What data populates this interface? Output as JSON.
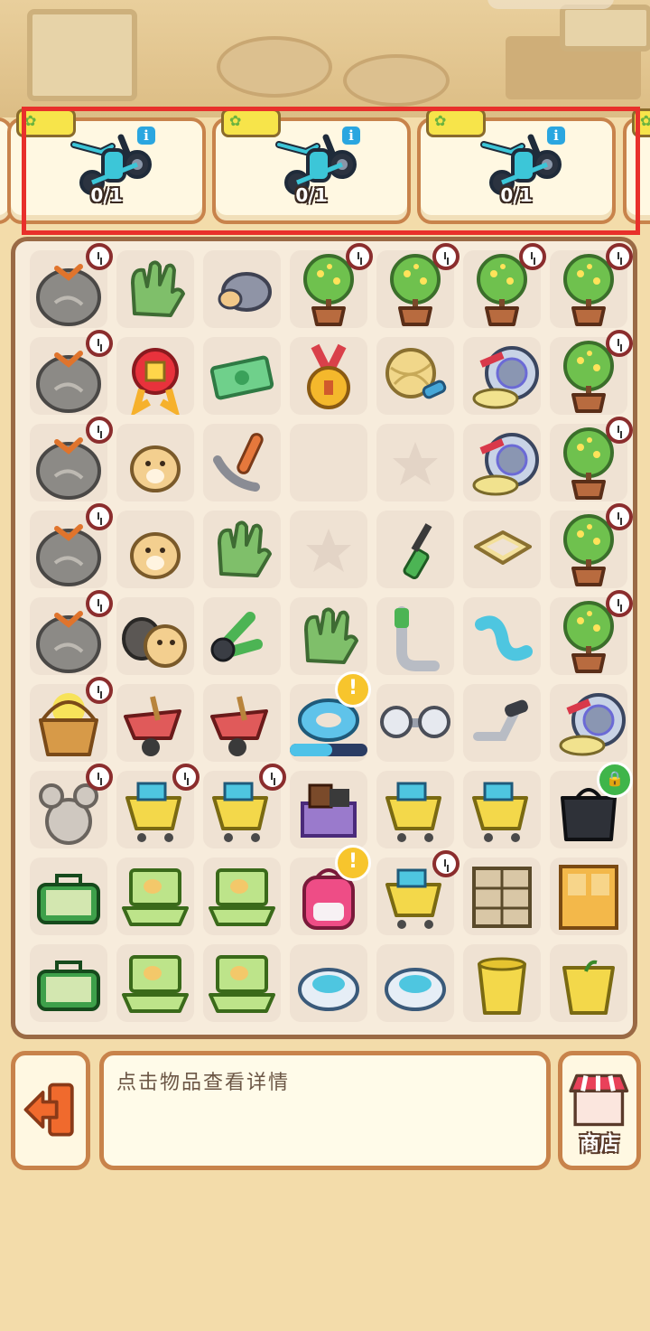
{
  "orders": [
    {
      "item": "scooter-icon",
      "count": "0/1"
    },
    {
      "item": "scooter-icon",
      "count": "0/1"
    },
    {
      "item": "scooter-icon",
      "count": "0/1"
    }
  ],
  "info_badge_symbol": "i",
  "board": {
    "rows": [
      [
        {
          "icon": "garbage-bag",
          "timer": true
        },
        {
          "icon": "green-glove"
        },
        {
          "icon": "hedgehog"
        },
        {
          "icon": "potted-tree",
          "timer": true
        },
        {
          "icon": "potted-tree",
          "timer": true
        },
        {
          "icon": "potted-tree",
          "timer": true
        },
        {
          "icon": "potted-tree",
          "timer": true
        }
      ],
      [
        {
          "icon": "garbage-bag",
          "timer": true
        },
        {
          "icon": "award-badge"
        },
        {
          "icon": "cash"
        },
        {
          "icon": "gold-medal"
        },
        {
          "icon": "yarn-ball"
        },
        {
          "icon": "robot-snail"
        },
        {
          "icon": "potted-tree",
          "timer": true
        }
      ],
      [
        {
          "icon": "garbage-bag",
          "timer": true
        },
        {
          "icon": "hamster"
        },
        {
          "icon": "pickaxe"
        },
        {
          "icon": "empty"
        },
        {
          "icon": "star-slot"
        },
        {
          "icon": "robot-snail"
        },
        {
          "icon": "potted-tree",
          "timer": true
        }
      ],
      [
        {
          "icon": "garbage-bag",
          "timer": true
        },
        {
          "icon": "hamster"
        },
        {
          "icon": "green-glove"
        },
        {
          "icon": "star-slot"
        },
        {
          "icon": "screwdriver"
        },
        {
          "icon": "frame"
        },
        {
          "icon": "potted-tree",
          "timer": true
        }
      ],
      [
        {
          "icon": "garbage-bag",
          "timer": true
        },
        {
          "icon": "hamster-pair"
        },
        {
          "icon": "pliers"
        },
        {
          "icon": "green-glove"
        },
        {
          "icon": "pipe"
        },
        {
          "icon": "blue-part"
        },
        {
          "icon": "potted-tree",
          "timer": true
        }
      ],
      [
        {
          "icon": "flower-basket",
          "timer": true
        },
        {
          "icon": "wheelbarrow"
        },
        {
          "icon": "wheelbarrow"
        },
        {
          "icon": "swim-ring",
          "alert": true,
          "progress": 0.55
        },
        {
          "icon": "dumbbell"
        },
        {
          "icon": "bike-part"
        },
        {
          "icon": "robot-snail"
        }
      ],
      [
        {
          "icon": "stone-mouse",
          "timer": true
        },
        {
          "icon": "shopping-cart",
          "timer": true
        },
        {
          "icon": "shopping-cart",
          "timer": true
        },
        {
          "icon": "gift-pile"
        },
        {
          "icon": "shopping-cart"
        },
        {
          "icon": "shopping-cart"
        },
        {
          "icon": "black-bag",
          "lock": true
        }
      ],
      [
        {
          "icon": "green-case"
        },
        {
          "icon": "laptop"
        },
        {
          "icon": "laptop"
        },
        {
          "icon": "pink-backpack",
          "alert": true
        },
        {
          "icon": "shopping-cart",
          "timer": true
        },
        {
          "icon": "cabinet"
        },
        {
          "icon": "locker"
        }
      ],
      [
        {
          "icon": "green-case"
        },
        {
          "icon": "laptop"
        },
        {
          "icon": "laptop"
        },
        {
          "icon": "robot-vacuum"
        },
        {
          "icon": "robot-vacuum"
        },
        {
          "icon": "trash-can"
        },
        {
          "icon": "plant-pot"
        }
      ]
    ]
  },
  "info_panel": {
    "text": "点击物品查看详情"
  },
  "buttons": {
    "exit_icon": "exit-icon",
    "shop_label": "商店"
  },
  "colors": {
    "highlight": "#e8302b",
    "panel_border": "#c8834b",
    "board_border": "#9a6a45"
  }
}
